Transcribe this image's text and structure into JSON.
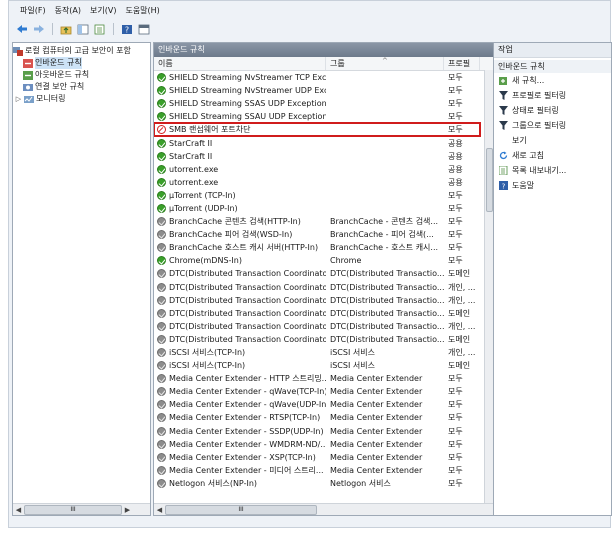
{
  "menu": [
    "파일(F)",
    "동작(A)",
    "보기(V)",
    "도움말(H)"
  ],
  "left": {
    "title": "로컬 컴퓨터의 고급 보안이 포함",
    "items": [
      {
        "label": "로컬 컴퓨터의 고급 보안이 포함",
        "level": 0
      },
      {
        "label": "인바운드 규칙",
        "level": 1
      },
      {
        "label": "아웃바운드 규칙",
        "level": 1
      },
      {
        "label": "연결 보안 규칙",
        "level": 1
      },
      {
        "label": "모니터링",
        "level": 1
      }
    ]
  },
  "center": {
    "title": "인바운드 규칙",
    "columns": [
      "이름",
      "그룹",
      "프로필"
    ],
    "rows": [
      {
        "name": "SHIELD Streaming NvStreamer TCP Exc...",
        "group": "",
        "profile": "모두",
        "state": "allow"
      },
      {
        "name": "SHIELD Streaming NvStreamer UDP Exc...",
        "group": "",
        "profile": "모두",
        "state": "allow"
      },
      {
        "name": "SHIELD Streaming SSAS UDP Exception",
        "group": "",
        "profile": "모두",
        "state": "allow"
      },
      {
        "name": "SHIELD Streaming SSAU UDP Exception",
        "group": "",
        "profile": "모두",
        "state": "allow"
      },
      {
        "name": "SMB 랜섬웨어 포트차단",
        "group": "",
        "profile": "모두",
        "state": "block"
      },
      {
        "name": "StarCraft II",
        "group": "",
        "profile": "공용",
        "state": "allow"
      },
      {
        "name": "StarCraft II",
        "group": "",
        "profile": "공용",
        "state": "allow"
      },
      {
        "name": "utorrent.exe",
        "group": "",
        "profile": "공용",
        "state": "allow"
      },
      {
        "name": "utorrent.exe",
        "group": "",
        "profile": "공용",
        "state": "allow"
      },
      {
        "name": "µTorrent (TCP-In)",
        "group": "",
        "profile": "모두",
        "state": "allow"
      },
      {
        "name": "µTorrent (UDP-In)",
        "group": "",
        "profile": "모두",
        "state": "allow"
      },
      {
        "name": "BranchCache 콘텐츠 검색(HTTP-In)",
        "group": "BranchCache - 콘텐츠 검색...",
        "profile": "모두",
        "state": "off"
      },
      {
        "name": "BranchCache 피어 검색(WSD-In)",
        "group": "BranchCache - 피어 검색(...",
        "profile": "모두",
        "state": "off"
      },
      {
        "name": "BranchCache 호스트 캐시 서버(HTTP-In)",
        "group": "BranchCache - 호스트 캐시...",
        "profile": "모두",
        "state": "off"
      },
      {
        "name": "Chrome(mDNS-In)",
        "group": "Chrome",
        "profile": "모두",
        "state": "allow"
      },
      {
        "name": "DTC(Distributed Transaction Coordinato...",
        "group": "DTC(Distributed Transactio...",
        "profile": "도메인",
        "state": "off"
      },
      {
        "name": "DTC(Distributed Transaction Coordinato...",
        "group": "DTC(Distributed Transactio...",
        "profile": "개인, ...",
        "state": "off"
      },
      {
        "name": "DTC(Distributed Transaction Coordinato...",
        "group": "DTC(Distributed Transactio...",
        "profile": "개인, ...",
        "state": "off"
      },
      {
        "name": "DTC(Distributed Transaction Coordinato...",
        "group": "DTC(Distributed Transactio...",
        "profile": "도메인",
        "state": "off"
      },
      {
        "name": "DTC(Distributed Transaction Coordinato...",
        "group": "DTC(Distributed Transactio...",
        "profile": "개인, ...",
        "state": "off"
      },
      {
        "name": "DTC(Distributed Transaction Coordinato...",
        "group": "DTC(Distributed Transactio...",
        "profile": "도메인",
        "state": "off"
      },
      {
        "name": "iSCSI 서비스(TCP-In)",
        "group": "iSCSI 서비스",
        "profile": "개인, ...",
        "state": "off"
      },
      {
        "name": "iSCSI 서비스(TCP-In)",
        "group": "iSCSI 서비스",
        "profile": "도메인",
        "state": "off"
      },
      {
        "name": "Media Center Extender - HTTP 스트리밍...",
        "group": "Media Center Extender",
        "profile": "모두",
        "state": "off"
      },
      {
        "name": "Media Center Extender - qWave(TCP-In)",
        "group": "Media Center Extender",
        "profile": "모두",
        "state": "off"
      },
      {
        "name": "Media Center Extender - qWave(UDP-In)",
        "group": "Media Center Extender",
        "profile": "모두",
        "state": "off"
      },
      {
        "name": "Media Center Extender - RTSP(TCP-In)",
        "group": "Media Center Extender",
        "profile": "모두",
        "state": "off"
      },
      {
        "name": "Media Center Extender - SSDP(UDP-In)",
        "group": "Media Center Extender",
        "profile": "모두",
        "state": "off"
      },
      {
        "name": "Media Center Extender - WMDRM-ND/...",
        "group": "Media Center Extender",
        "profile": "모두",
        "state": "off"
      },
      {
        "name": "Media Center Extender - XSP(TCP-In)",
        "group": "Media Center Extender",
        "profile": "모두",
        "state": "off"
      },
      {
        "name": "Media Center Extender - 미디어 스트리...",
        "group": "Media Center Extender",
        "profile": "모두",
        "state": "off"
      },
      {
        "name": "Netlogon 서비스(NP-In)",
        "group": "Netlogon 서비스",
        "profile": "모두",
        "state": "off"
      }
    ]
  },
  "actions": {
    "title": "작업",
    "section": "인바운드 규칙",
    "items": [
      {
        "label": "새 규칙...",
        "icon": "new-rule-icon"
      },
      {
        "label": "프로필로 필터링",
        "icon": "filter-icon"
      },
      {
        "label": "상태로 필터링",
        "icon": "filter-icon"
      },
      {
        "label": "그룹으로 필터링",
        "icon": "filter-icon"
      },
      {
        "label": "보기",
        "icon": "view-icon"
      },
      {
        "label": "새로 고침",
        "icon": "refresh-icon"
      },
      {
        "label": "목록 내보내기...",
        "icon": "export-icon"
      },
      {
        "label": "도움말",
        "icon": "help-icon"
      }
    ]
  },
  "scroll": {
    "h_label": "III"
  }
}
